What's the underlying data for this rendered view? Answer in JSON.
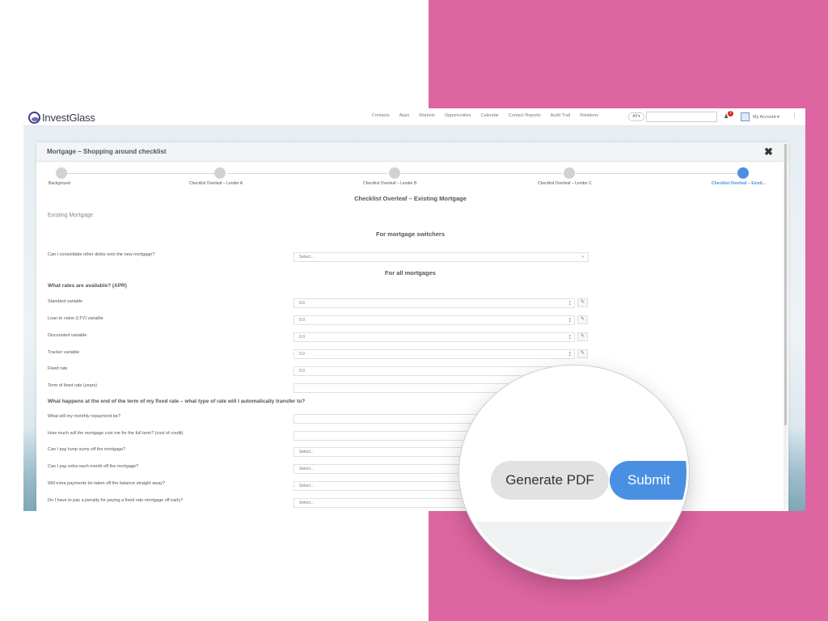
{
  "logo": {
    "text": "InvestGlass"
  },
  "nav": [
    "Contacts",
    "Apps",
    "Markets",
    "Opportunities",
    "Calendar",
    "Contact Reports",
    "Audit Trail",
    "Relations"
  ],
  "topbar": {
    "scope": "All ▾",
    "notifications": "2",
    "account": "My Account ▾"
  },
  "modal": {
    "title": "Mortgage – Shopping around checklist",
    "steps": [
      "Background",
      "Checklist Overleaf – Lender A",
      "Checklist Overleaf – Lender B",
      "Checklist Overleaf – Lender C",
      "Checklist Overleaf – Existi..."
    ],
    "active_step": 4,
    "page_title": "Checklist Overleaf – Existing Mortgage",
    "section": "Existing Mortgage",
    "switchers_title": "For mortgage switchers",
    "all_title": "For all mortgages",
    "rates_title": "What rates are available? (APR)",
    "end_term_title": "What happens at the end of the term of my fixed rate – what type of rate will I automatically transfer to?",
    "q_consolidate": "Can I consolidate other debts onto the new mortgage?",
    "q_standard": "Standard variable",
    "q_ltv": "Loan to value (LTV) variable",
    "q_discounted": "Discounted variable",
    "q_tracker": "Tracker variable",
    "q_fixed": "Fixed rate",
    "q_term": "Term of fixed rate (years)",
    "q_monthly": "What will my monthly repayment be?",
    "q_full_term": "How much will the mortgage cost me for the full term? (cost of credit)",
    "q_lump": "Can I pay lump sums off the mortgage?",
    "q_extra": "Can I pay extra each month off the mortgage?",
    "q_taken_off": "Will extra payments be taken off the balance straight away?",
    "q_penalty": "Do I have to pay a penalty for paying a fixed rate mortgage off early?",
    "select_placeholder": "Select...",
    "number_value": "0.0"
  },
  "buttons": {
    "generate_pdf": "Generate PDF",
    "submit": "Submit"
  },
  "colors": {
    "pink_background": "#dd65a1",
    "accent_blue": "#4a90e2"
  }
}
